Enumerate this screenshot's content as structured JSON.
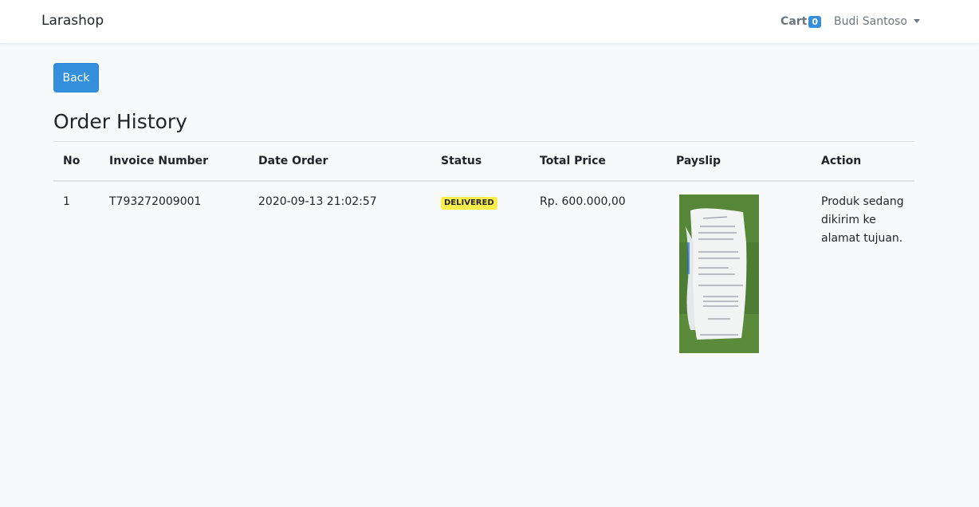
{
  "navbar": {
    "brand": "Larashop",
    "cart_label": "Cart",
    "cart_count": "0",
    "user_name": "Budi Santoso"
  },
  "back_label": "Back",
  "page_title": "Order History",
  "table": {
    "headers": [
      "No",
      "Invoice Number",
      "Date Order",
      "Status",
      "Total Price",
      "Payslip",
      "Action"
    ],
    "rows": [
      {
        "no": "1",
        "invoice": "T793272009001",
        "date": "2020-09-13 21:02:57",
        "status": "DELIVERED",
        "total": "Rp. 600.000,00",
        "action": "Produk sedang dikirim ke alamat tujuan."
      }
    ]
  },
  "colors": {
    "primary": "#3490dc",
    "status_delivered": "#ffed4a"
  }
}
